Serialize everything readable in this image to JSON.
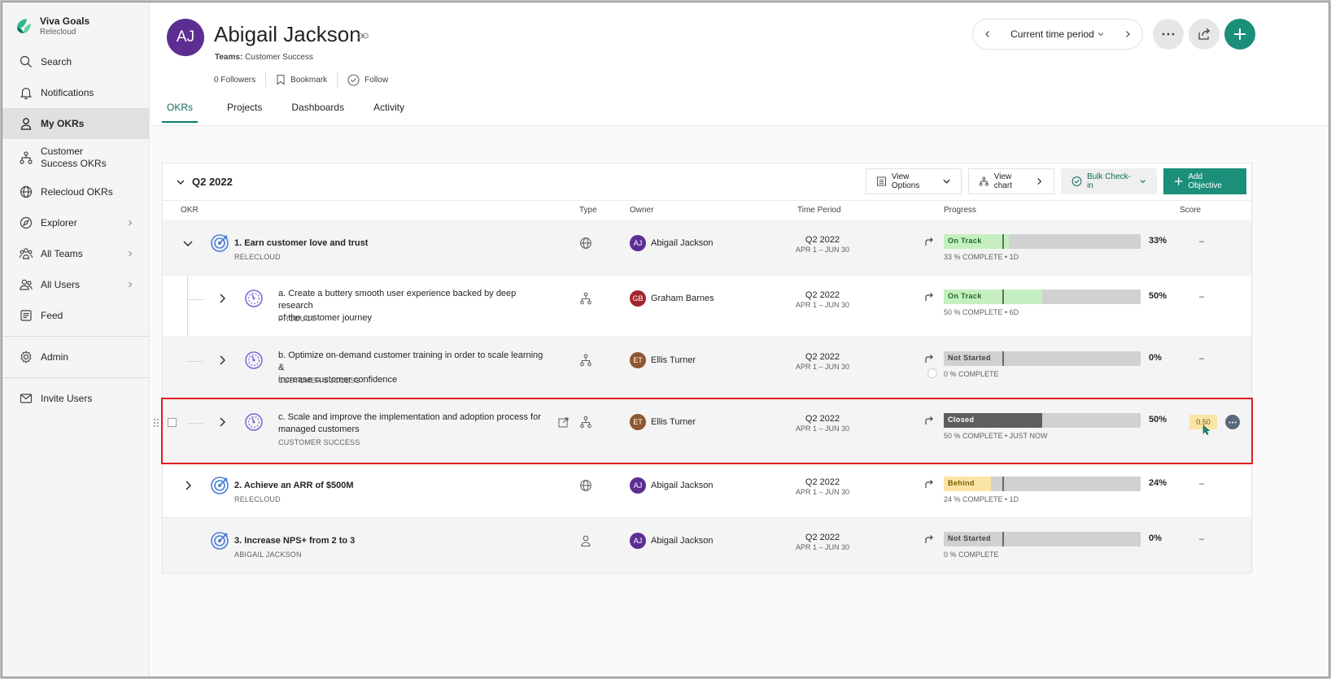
{
  "brand": {
    "name": "Viva Goals",
    "org": "Relecloud"
  },
  "sidebar": {
    "items": [
      {
        "label": "Search",
        "icon": "search-icon"
      },
      {
        "label": "Notifications",
        "icon": "bell-icon"
      },
      {
        "label": "My OKRs",
        "icon": "person-icon",
        "active": true
      },
      {
        "label": "Customer Success OKRs",
        "icon": "org-icon"
      },
      {
        "label": "Relecloud OKRs",
        "icon": "globe-icon"
      },
      {
        "label": "Explorer",
        "icon": "compass-icon",
        "chevron": true
      },
      {
        "label": "All Teams",
        "icon": "teams-icon",
        "chevron": true
      },
      {
        "label": "All Users",
        "icon": "users-icon",
        "chevron": true
      },
      {
        "label": "Feed",
        "icon": "feed-icon"
      },
      {
        "label": "Admin",
        "icon": "gear-icon"
      },
      {
        "label": "Invite Users",
        "icon": "mail-icon"
      }
    ]
  },
  "profile": {
    "initials": "AJ",
    "name": "Abigail Jackson",
    "teams_label": "Teams:",
    "teams_value": "Customer Success",
    "followers": "0 Followers",
    "bookmark": "Bookmark",
    "follow": "Follow"
  },
  "tabs": [
    {
      "label": "OKRs",
      "active": true
    },
    {
      "label": "Projects"
    },
    {
      "label": "Dashboards"
    },
    {
      "label": "Activity"
    }
  ],
  "time_period": {
    "label": "Current time period"
  },
  "card": {
    "period": "Q2 2022",
    "view_options": "View Options",
    "view_chart": "View chart",
    "bulk_checkin": "Bulk Check-in",
    "add_objective": "Add Objective"
  },
  "columns": {
    "okr": "OKR",
    "type": "Type",
    "owner": "Owner",
    "time_period": "Time Period",
    "progress": "Progress",
    "score": "Score"
  },
  "rows": [
    {
      "title": "1. Earn customer love and trust",
      "sub": "RELECLOUD",
      "owner": "Abigail Jackson",
      "owner_initials": "AJ",
      "period": "Q2 2022",
      "range": "APR 1 – JUN 30",
      "status": "On Track",
      "progress": 0.33,
      "pct": "33%",
      "progress_sub": "33 % COMPLETE • 1D",
      "score": "–"
    },
    {
      "title_line1": "a. Create a buttery smooth user experience backed by deep research",
      "title_line2": "of the customer journey",
      "sub": "PRODUCT",
      "owner": "Graham Barnes",
      "owner_initials": "GB",
      "period": "Q2 2022",
      "range": "APR 1 – JUN 30",
      "status": "On Track",
      "progress": 0.5,
      "pct": "50%",
      "progress_sub": "50 % COMPLETE • 6D",
      "score": "–"
    },
    {
      "title_line1": "b. Optimize on-demand customer training in order to scale learning &",
      "title_line2": "increase customer confidence",
      "sub": "CUSTOMER SUCCESS",
      "owner": "Ellis Turner",
      "owner_initials": "ET",
      "period": "Q2 2022",
      "range": "APR 1 – JUN 30",
      "status": "Not Started",
      "progress": 0.0,
      "pct": "0%",
      "progress_sub": "0 % COMPLETE",
      "score": "–"
    },
    {
      "title_line1": "c. Scale and improve the implementation and adoption process for",
      "title_line2": "managed customers",
      "sub": "CUSTOMER SUCCESS",
      "owner": "Ellis Turner",
      "owner_initials": "ET",
      "period": "Q2 2022",
      "range": "APR 1 – JUN 30",
      "status": "Closed",
      "progress": 0.5,
      "pct": "50%",
      "progress_sub": "50 % COMPLETE • JUST NOW",
      "score": "0.50"
    },
    {
      "title": "2. Achieve an ARR of $500M",
      "sub": "RELECLOUD",
      "owner": "Abigail Jackson",
      "owner_initials": "AJ",
      "period": "Q2 2022",
      "range": "APR 1 – JUN 30",
      "status": "Behind",
      "progress": 0.24,
      "pct": "24%",
      "progress_sub": "24 % COMPLETE • 1D",
      "score": "–"
    },
    {
      "title": "3. Increase NPS+ from 2 to 3",
      "sub": "ABIGAIL JACKSON",
      "owner": "Abigail Jackson",
      "owner_initials": "AJ",
      "period": "Q2 2022",
      "range": "APR 1 – JUN 30",
      "status": "Not Started",
      "progress": 0.0,
      "pct": "0%",
      "progress_sub": "0 % COMPLETE",
      "score": "–"
    }
  ],
  "colors": {
    "accent": "#1b8f7a",
    "on_track": "#c5efc1",
    "on_track_text": "#1d6b22",
    "behind": "#fbe5a5",
    "behind_text": "#7a5a00",
    "closed": "#5e5e5e",
    "not_started": "#d1d1d1",
    "highlight": "#e01e1e",
    "avatar_aj": "#5c2e91",
    "avatar_gb": "#a4262c",
    "avatar_et": "#8e562e"
  }
}
